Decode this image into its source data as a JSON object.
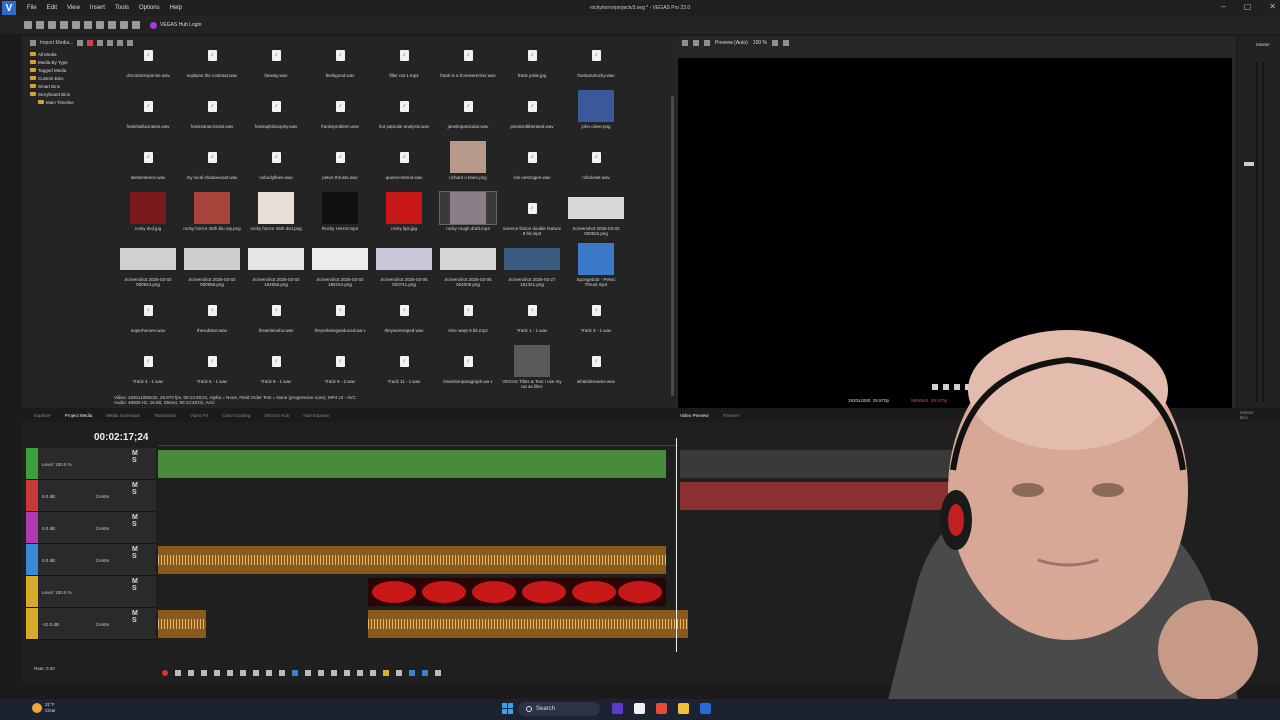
{
  "app": {
    "window_title": "rockyhorrorprojectv3.veg * - VEGAS Pro 23.0",
    "menu": [
      "File",
      "Edit",
      "View",
      "Insert",
      "Tools",
      "Options",
      "Help"
    ],
    "hub_login": "VEGAS Hub Login"
  },
  "explorer": {
    "import_label": "Import Media...",
    "tree": [
      "All Media",
      "Media By Type",
      "Tagged Media",
      "Custom Bins",
      "Smart Bins",
      "Storyboard Bins",
      "Main Timeline"
    ],
    "media": [
      {
        "name": "drscottsresponse.wav",
        "kind": "audio"
      },
      {
        "name": "explains the contrast.wav",
        "kind": "audio"
      },
      {
        "name": "faeway.wav",
        "kind": "audio"
      },
      {
        "name": "feelsgood.wav",
        "kind": "audio"
      },
      {
        "name": "filler cat 1.mp4",
        "kind": "audio"
      },
      {
        "name": "frank is a homewrecker.wav",
        "kind": "audio"
      },
      {
        "name": "frank pride.jpg",
        "kind": "audio"
      },
      {
        "name": "frankandrocky.wav",
        "kind": "audio"
      },
      {
        "name": "frankhallucinates.wav",
        "kind": "audio"
      },
      {
        "name": "franksanarcissist.wav",
        "kind": "audio"
      },
      {
        "name": "franksphilosophy.wav",
        "kind": "audio"
      },
      {
        "name": "franksproblem.wav",
        "kind": "audio"
      },
      {
        "name": "hot patootie analysis.wav",
        "kind": "audio"
      },
      {
        "name": "janetinparticular.wav",
        "kind": "audio"
      },
      {
        "name": "janetisntliberated.wav",
        "kind": "audio"
      },
      {
        "name": "john oliver.png",
        "kind": "img",
        "color": "#3a5a9c"
      },
      {
        "name": "lastsentence.wav",
        "kind": "audio"
      },
      {
        "name": "my local shadowcast.wav",
        "kind": "audio"
      },
      {
        "name": "nobodyflees.wav",
        "kind": "audio"
      },
      {
        "name": "pelvic thrusts.wav",
        "kind": "audio"
      },
      {
        "name": "queercontend.wav",
        "kind": "audio"
      },
      {
        "name": "richard o brien.png",
        "kind": "img",
        "color": "#b89a8a"
      },
      {
        "name": "rob oestrogen.wav",
        "kind": "audio"
      },
      {
        "name": "robcloset.wav",
        "kind": "audio"
      },
      {
        "name": "rocky dvd.jpg",
        "kind": "img",
        "color": "#7a1a1a"
      },
      {
        "name": "rocky horror 35th blu ray.png",
        "kind": "img",
        "color": "#a8443a"
      },
      {
        "name": "rocky horror 45th dvd.png",
        "kind": "img",
        "color": "#e8e0d8"
      },
      {
        "name": "Rocky Horror.mp4",
        "kind": "img",
        "color": "#111111"
      },
      {
        "name": "rocky lips.jpg",
        "kind": "img",
        "color": "#c81818"
      },
      {
        "name": "rocky rough draft.mp4",
        "kind": "img",
        "color": "#8a7f86",
        "selected": true
      },
      {
        "name": "science fiction double feature 8 bit.mp3",
        "kind": "audio"
      },
      {
        "name": "Screenshot 2026-03-02 000922.png",
        "kind": "wide",
        "color": "#d8d8d8"
      },
      {
        "name": "Screenshot 2026-03-02 000944.png",
        "kind": "wide",
        "color": "#d0d0d0"
      },
      {
        "name": "Screenshot 2026-03-02 000958.png",
        "kind": "wide",
        "color": "#cfcfcf"
      },
      {
        "name": "Screenshot 2026-03-02 184656.png",
        "kind": "wide",
        "color": "#e6e6e6"
      },
      {
        "name": "Screenshot 2026-03-02 185154.png",
        "kind": "wide",
        "color": "#ececec"
      },
      {
        "name": "Screenshot 2026-03-05 003741.png",
        "kind": "wide",
        "color": "#c8c8d8"
      },
      {
        "name": "Screenshot 2026-03-05 004008.png",
        "kind": "wide",
        "color": "#d6d6d6"
      },
      {
        "name": "Screenshot 2026-03-27 181341.png",
        "kind": "wide",
        "color": "#3a5a80"
      },
      {
        "name": "Spongebob - Pelvic Thrust.mp4",
        "kind": "img",
        "color": "#3a7ac8"
      },
      {
        "name": "superheroes.wav",
        "kind": "audio"
      },
      {
        "name": "thesubtext.wav",
        "kind": "audio"
      },
      {
        "name": "thewriterwho.wav",
        "kind": "audio"
      },
      {
        "name": "theyrebeingseduced.wa v",
        "kind": "audio"
      },
      {
        "name": "theywereraped.wav",
        "kind": "audio"
      },
      {
        "name": "time warp 8 bit.mp3",
        "kind": "audio"
      },
      {
        "name": "Track 1 - 1.wav",
        "kind": "audio"
      },
      {
        "name": "Track 3 - 1.wav",
        "kind": "audio"
      },
      {
        "name": "Track 4 - 1.wav",
        "kind": "audio"
      },
      {
        "name": "Track 6 - 1.wav",
        "kind": "audio"
      },
      {
        "name": "Track 9 - 1.wav",
        "kind": "audio"
      },
      {
        "name": "Track 9 - 2.wav",
        "kind": "audio"
      },
      {
        "name": "Track 11 - 1.wav",
        "kind": "audio"
      },
      {
        "name": "transitionparagraph.wa v",
        "kind": "audio"
      },
      {
        "name": "VEGAS Titles & Text I use my cat as filler.",
        "kind": "img",
        "color": "#5a5a5a"
      },
      {
        "name": "whatshisname.wav",
        "kind": "audio"
      }
    ],
    "status_line1": "Video: 1920x1080x32, 29.970 fps, 00:13:49;01, Alpha = None, Field Order Test = None (progressive scan), MP4 v2 - AVC",
    "status_line2": "Audio: 48000 Hz, 16 Bit, Stereo, 00:13:49;01, AAC"
  },
  "tabs_left": [
    "Explorer",
    "Project Media",
    "Media Generator",
    "Transitions",
    "Video FX",
    "Color Grading",
    "VEGAS Hub",
    "Hub Explorer"
  ],
  "tabs_right": [
    "Video Preview",
    "Trimmer"
  ],
  "preview": {
    "mode": "Preview (Auto)",
    "zoom": "100 %",
    "resolution": "1920x1080, 29.970p",
    "frame_info": "960x540, 29.970p"
  },
  "master": {
    "label": "Master",
    "bus_label": "Master Bus"
  },
  "timeline": {
    "timecode": "00:02:17;24",
    "tracks": [
      {
        "level": "Level: 100.0 %",
        "center": "",
        "color": "#3aa03a"
      },
      {
        "level": "5.0 dB",
        "center": "Center",
        "color": "#c83a3a"
      },
      {
        "level": "0.0 dB",
        "center": "Center",
        "color": "#b03ab0"
      },
      {
        "level": "0.0 dB",
        "center": "Center",
        "color": "#3a8ad8"
      },
      {
        "level": "Level: 100.0 %",
        "center": "",
        "color": "#d8a82a"
      },
      {
        "level": "-42.0 dB",
        "center": "Center",
        "color": "#d8a82a"
      }
    ],
    "rate": "Rate: 0.00",
    "ms_label": "M S"
  },
  "taskbar": {
    "temperature": "31°F",
    "condition": "Clear",
    "search": "Search"
  }
}
